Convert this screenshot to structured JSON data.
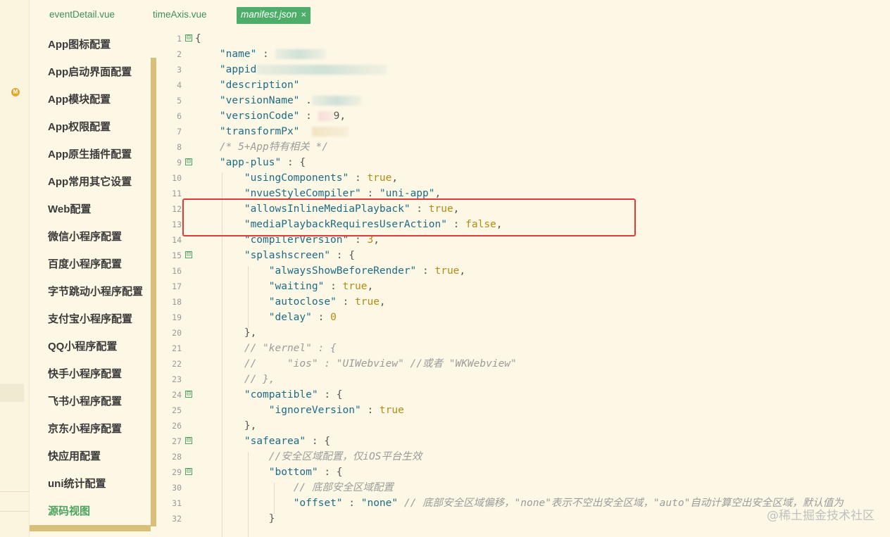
{
  "tabs": [
    {
      "label": "eventDetail.vue"
    },
    {
      "label": "timeAxis.vue"
    },
    {
      "label": "manifest.json",
      "close": "×"
    }
  ],
  "badge": "M",
  "sidebar": {
    "items": [
      {
        "label": "App图标配置"
      },
      {
        "label": "App启动界面配置"
      },
      {
        "label": "App模块配置"
      },
      {
        "label": "App权限配置"
      },
      {
        "label": "App原生插件配置"
      },
      {
        "label": "App常用其它设置"
      },
      {
        "label": "Web配置"
      },
      {
        "label": "微信小程序配置"
      },
      {
        "label": "百度小程序配置"
      },
      {
        "label": "字节跳动小程序配置"
      },
      {
        "label": "支付宝小程序配置"
      },
      {
        "label": "QQ小程序配置"
      },
      {
        "label": "快手小程序配置"
      },
      {
        "label": "飞书小程序配置"
      },
      {
        "label": "京东小程序配置"
      },
      {
        "label": "快应用配置"
      },
      {
        "label": "uni统计配置"
      },
      {
        "label": "源码视图"
      }
    ]
  },
  "editor": {
    "line_numbers": [
      "1",
      "2",
      "3",
      "4",
      "5",
      "6",
      "7",
      "8",
      "9",
      "10",
      "11",
      "12",
      "13",
      "14",
      "15",
      "16",
      "17",
      "18",
      "19",
      "20",
      "21",
      "22",
      "23",
      "24",
      "25",
      "26",
      "27",
      "28",
      "29",
      "30",
      "31",
      "32"
    ],
    "fold_glyph": "⊟",
    "l1": "{",
    "l2k": "\"name\"",
    "l2p": " : ",
    "l3k": "\"appid",
    "l4k": "\"description\"",
    "l5k": "\"versionName\"",
    "l5p": " .",
    "l6k": "\"versionCode\"",
    "l6p": " : ",
    "l6v": "9,",
    "l7k": "\"transformPx\"",
    "l8c": "/* 5+App特有相关 */",
    "l9k": "\"app-plus\"",
    "l9p": " : {",
    "l10k": "\"usingComponents\"",
    "l10p": " : ",
    "l10v": "true",
    "l10e": ",",
    "l11k": "\"nvueStyleCompiler\"",
    "l11p": " : ",
    "l11v": "\"uni-app\"",
    "l11e": ",",
    "l12k": "\"allowsInlineMediaPlayback\"",
    "l12p": " : ",
    "l12v": "true",
    "l12e": ",",
    "l13k": "\"mediaPlaybackRequiresUserAction\"",
    "l13p": " : ",
    "l13v": "false",
    "l13e": ",",
    "l14k": "\"compilerVersion\"",
    "l14p": " : ",
    "l14v": "3",
    "l14e": ",",
    "l15k": "\"splashscreen\"",
    "l15p": " : {",
    "l16k": "\"alwaysShowBeforeRender\"",
    "l16p": " : ",
    "l16v": "true",
    "l16e": ",",
    "l17k": "\"waiting\"",
    "l17p": " : ",
    "l17v": "true",
    "l17e": ",",
    "l18k": "\"autoclose\"",
    "l18p": " : ",
    "l18v": "true",
    "l18e": ",",
    "l19k": "\"delay\"",
    "l19p": " : ",
    "l19v": "0",
    "l20": "},",
    "l21c": "// \"kernel\" : {",
    "l22c": "//     \"ios\" : \"UIWebview\" //或者 \"WKWebview\"",
    "l23c": "// },",
    "l24k": "\"compatible\"",
    "l24p": " : {",
    "l25k": "\"ignoreVersion\"",
    "l25p": " : ",
    "l25v": "true",
    "l26": "},",
    "l27k": "\"safearea\"",
    "l27p": " : {",
    "l28c": "//安全区域配置，仅iOS平台生效",
    "l29k": "\"bottom\"",
    "l29p": " : {",
    "l30c": "// 底部安全区域配置",
    "l31k": "\"offset\"",
    "l31p": " : ",
    "l31v": "\"none\"",
    "l31c": " // 底部安全区域偏移，\"none\"表示不空出安全区域，\"auto\"自动计算空出安全区域，默认值为",
    "l32": "}"
  },
  "watermark": "@稀土掘金技术社区",
  "colors": {
    "accent": "#4cae68",
    "highlight": "#e13a3a"
  }
}
